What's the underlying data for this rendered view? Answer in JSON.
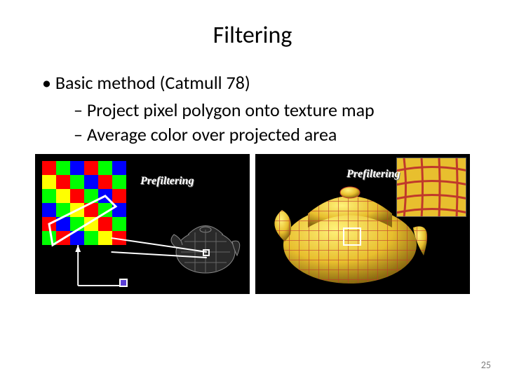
{
  "title": "Filtering",
  "bullets": {
    "main": "Basic method (Catmull 78)",
    "sub1": "Project pixel polygon onto texture map",
    "sub2": "Average color over projected area"
  },
  "figures": {
    "left_label": "Prefiltering",
    "right_label": "Prefiltering"
  },
  "checker_colors": [
    "#ff0000",
    "#00ff00",
    "#0000ff",
    "#ff0000",
    "#00ff00",
    "#0000ff",
    "#ffff00",
    "#ff0000",
    "#00ff00",
    "#0000ff",
    "#ff0000",
    "#00ff00",
    "#00ff00",
    "#ffff00",
    "#ff0000",
    "#00ff00",
    "#0000ff",
    "#ff0000",
    "#0000ff",
    "#00ff00",
    "#ffff00",
    "#ff0000",
    "#00ff00",
    "#0000ff",
    "#ff0000",
    "#0000ff",
    "#00ff00",
    "#ffff00",
    "#ff0000",
    "#00ff00",
    "#00ff00",
    "#ff0000",
    "#0000ff",
    "#00ff00",
    "#ffff00",
    "#ff0000"
  ],
  "page_number": "25"
}
